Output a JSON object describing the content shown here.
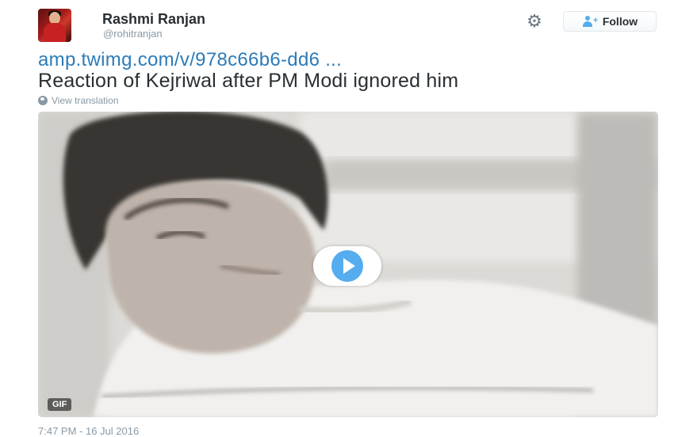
{
  "user": {
    "display_name": "Rashmi Ranjan",
    "screen_name": "@rohitranjan"
  },
  "actions": {
    "follow_label": "Follow",
    "settings_icon": "gear-icon"
  },
  "tweet": {
    "link_text": "amp.twimg.com/v/978c66b6-dd6 ...",
    "text": "Reaction of Kejriwal after PM Modi ignored him",
    "translation_label": "View translation",
    "timestamp": "7:47 PM - 16 Jul 2016"
  },
  "media": {
    "badge": "GIF",
    "play_icon": "play-icon"
  },
  "colors": {
    "link": "#2b7bb9",
    "accent": "#55acee",
    "muted": "#8899a6"
  }
}
